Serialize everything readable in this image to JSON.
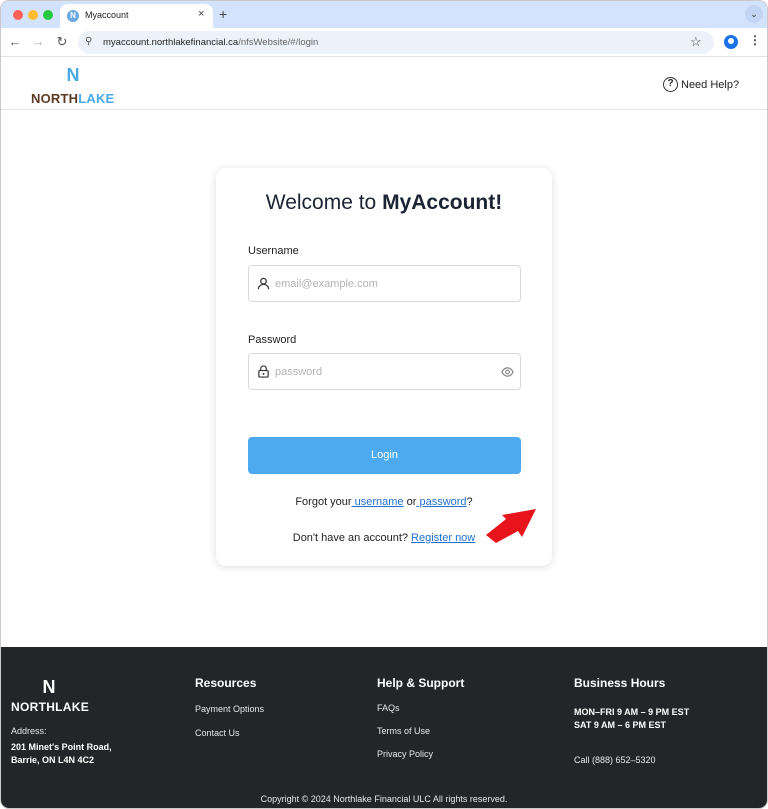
{
  "browser": {
    "tab_title": "Myaccount",
    "tab_favicon": "N",
    "tab_close": "×",
    "new_tab": "+",
    "url_domain": "myaccount.northlakefinancial.ca",
    "url_path": "/nfsWebsite/#/login"
  },
  "header": {
    "logo_mark": "N",
    "logo_north": "NORTH",
    "logo_lake": "LAKE",
    "need_help": "Need Help?"
  },
  "login": {
    "title_prefix": "Welcome to ",
    "title_bold": "MyAccount!",
    "username_label": "Username",
    "username_placeholder": "email@example.com",
    "password_label": "Password",
    "password_placeholder": "password",
    "login_button": "Login",
    "forgot_prefix": "Forgot your",
    "forgot_username": " username",
    "forgot_or": " or",
    "forgot_password": " password",
    "forgot_suffix": "?",
    "register_prefix": "Don't have an account? ",
    "register_link": "Register now"
  },
  "footer": {
    "logo_mark": "N",
    "logo_text": "NORTHLAKE",
    "address_label": "Address:",
    "address_line1": "201 Minet's Point Road,",
    "address_line2": "Barrie, ON L4N 4C2",
    "resources_heading": "Resources",
    "resources_links": [
      "Payment Options",
      "Contact Us"
    ],
    "help_heading": "Help & Support",
    "help_links": [
      "FAQs",
      "Terms of Use",
      "Privacy Policy"
    ],
    "hours_heading": "Business Hours",
    "hours_line1": "MON–FRI 9 AM – 9 PM EST",
    "hours_line2": "SAT 9 AM – 6 PM EST",
    "phone": "Call (888) 652–5320",
    "copyright": "Copyright © 2024 Northlake Financial ULC All rights reserved."
  },
  "colors": {
    "accent_blue": "#4daaf0",
    "footer_bg": "#232528",
    "link_blue": "#1f6fd1",
    "arrow_red": "#e8141b"
  },
  "icons": [
    "back-arrow-icon",
    "forward-arrow-icon",
    "reload-icon",
    "site-info-icon",
    "bookmark-star-icon",
    "profile-icon",
    "menu-kebab-icon",
    "help-circle-icon",
    "user-icon",
    "lock-icon",
    "eye-icon",
    "red-arrow-icon"
  ]
}
